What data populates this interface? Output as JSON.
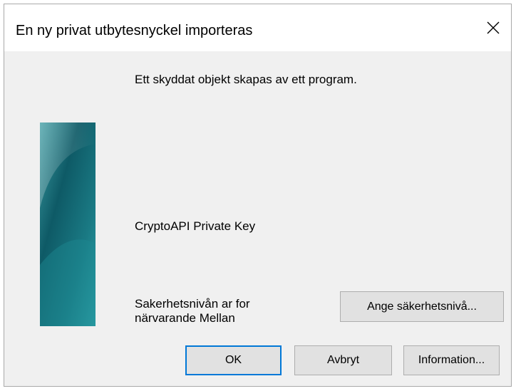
{
  "dialog": {
    "title": "En ny privat utbytesnyckel importeras",
    "message": "Ett skyddat objekt skapas av ett program.",
    "key_name": "CryptoAPI Private Key",
    "security_level_line1": "Sakerhetsnivån ar for",
    "security_level_line2": "närvarande Mellan",
    "buttons": {
      "set_security_level": "Ange säkerhetsnivå...",
      "ok": "OK",
      "cancel": "Avbryt",
      "information": "Information..."
    }
  },
  "colors": {
    "window_background": "#f0f0f0",
    "titlebar_background": "#ffffff",
    "button_face": "#e1e1e1",
    "button_border": "#adadad",
    "default_button_border": "#0078d7",
    "banner_dark": "#0b4f5c",
    "banner_light": "#2a8f98"
  },
  "icons": {
    "close": "close-icon",
    "banner": "security-banner-graphic"
  }
}
